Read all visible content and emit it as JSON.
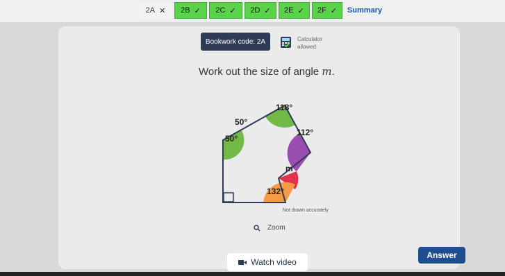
{
  "tabs": [
    {
      "label": "2A",
      "mark": "✕",
      "state": "wrong"
    },
    {
      "label": "2B",
      "mark": "✓",
      "state": "done"
    },
    {
      "label": "2C",
      "mark": "✓",
      "state": "done"
    },
    {
      "label": "2D",
      "mark": "✓",
      "state": "done"
    },
    {
      "label": "2E",
      "mark": "✓",
      "state": "done"
    },
    {
      "label": "2F",
      "mark": "✓",
      "state": "done"
    },
    {
      "label": "Summary",
      "mark": "",
      "state": "summary"
    }
  ],
  "bookwork": {
    "label": "Bookwork code: 2A"
  },
  "calculator": {
    "line1": "Calculator",
    "line2": "allowed"
  },
  "question": {
    "text": "Work out the size of angle ",
    "var": "m",
    "end": "."
  },
  "diagram": {
    "angles": {
      "a1": "50°",
      "a2": "50°",
      "a3": "118°",
      "a4": "112°",
      "a5": "m",
      "a6": "132°"
    },
    "colors": {
      "green": "#72b947",
      "yellow": "#f4d43e",
      "purple": "#9a4fb0",
      "red": "#e0334e",
      "orange": "#f59a45"
    }
  },
  "note": "Not drawn accurately",
  "zoom": {
    "label": "Zoom"
  },
  "watch": {
    "label": "Watch video"
  },
  "answer": {
    "label": "Answer"
  }
}
